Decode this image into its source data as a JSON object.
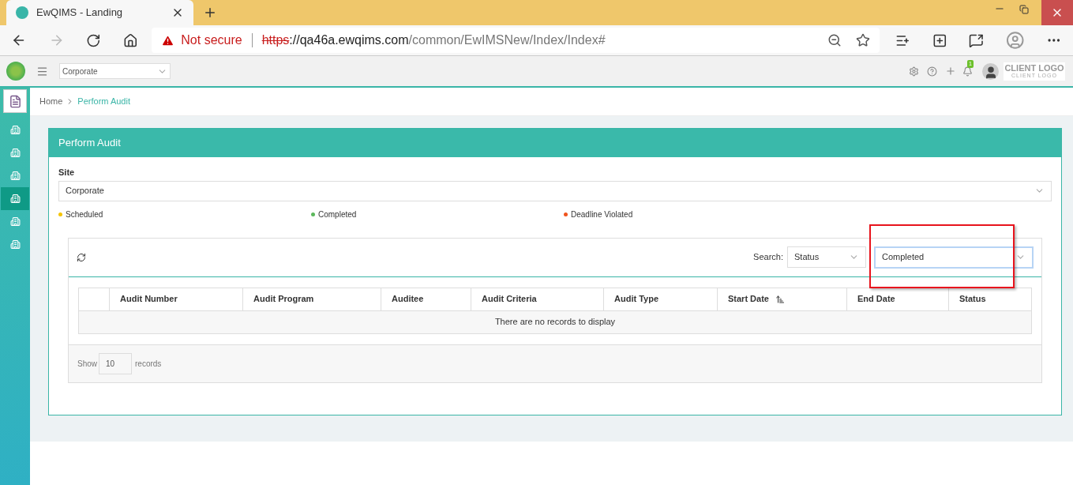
{
  "browser": {
    "tab_title": "EwQIMS - Landing",
    "security": "Not secure",
    "url_scheme": "https",
    "url_host": "://qa46a.ewqims.com",
    "url_path": "/common/EwIMSNew/Index/Index#"
  },
  "header": {
    "site_select": "Corporate",
    "notification_count": "1",
    "logo_text": "CLIENT LOGO",
    "logo_subtext": "CLIENT LOGO"
  },
  "sidebar": {
    "items": [
      {
        "kind": "document",
        "selected": false
      },
      {
        "kind": "building",
        "selected": false
      },
      {
        "kind": "building",
        "selected": false
      },
      {
        "kind": "building",
        "selected": false
      },
      {
        "kind": "building",
        "selected": true
      },
      {
        "kind": "building",
        "selected": false
      },
      {
        "kind": "building",
        "selected": false
      }
    ]
  },
  "breadcrumb": [
    "Home",
    "Perform Audit"
  ],
  "panel": {
    "title": "Perform Audit",
    "site_label": "Site",
    "site_value": "Corporate",
    "legend": [
      {
        "label": "Scheduled",
        "color": "#f5c400"
      },
      {
        "label": "Completed",
        "color": "#5cb85c"
      },
      {
        "label": "Deadline Violated",
        "color": "#f0541e"
      }
    ],
    "search_label": "Search:",
    "search_field": "Status",
    "search_value": "Completed",
    "search_value_highlighted": true,
    "table": {
      "columns": [
        {
          "label": "Audit Number",
          "sorted": false
        },
        {
          "label": "Audit Program",
          "sorted": false
        },
        {
          "label": "Auditee",
          "sorted": false
        },
        {
          "label": "Audit Criteria",
          "sorted": false
        },
        {
          "label": "Audit Type",
          "sorted": false
        },
        {
          "label": "Start Date",
          "sorted": true
        },
        {
          "label": "End Date",
          "sorted": false
        },
        {
          "label": "Status",
          "sorted": false
        }
      ],
      "empty_message": "There are no records to display"
    },
    "show_label": "Show",
    "page_size": "10",
    "records_label": "records"
  }
}
